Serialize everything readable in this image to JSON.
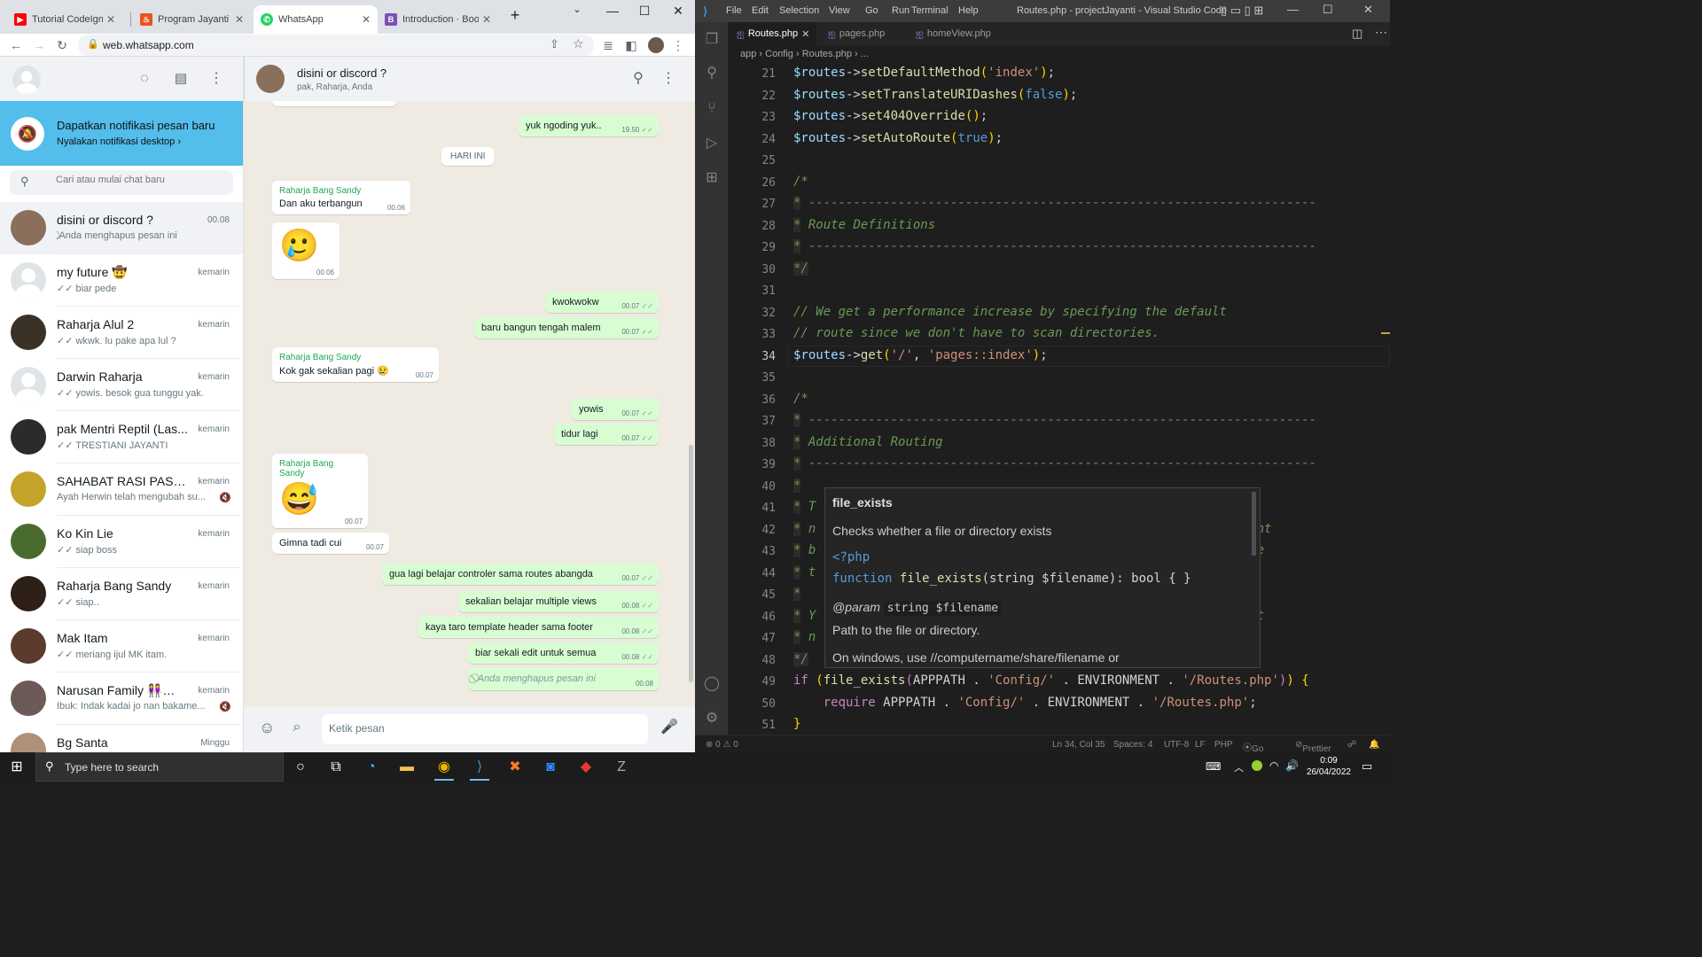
{
  "chrome": {
    "tabs": [
      {
        "title": "Tutorial CodeIgniter",
        "favicon_color": "#ff0000",
        "favicon_glyph": "▶"
      },
      {
        "title": "Program Jayanti",
        "favicon_color": "#e8541c",
        "favicon_glyph": "🔥"
      },
      {
        "title": "WhatsApp",
        "favicon_color": "#25d366",
        "favicon_glyph": "✆"
      },
      {
        "title": "Introduction · Boots",
        "favicon_color": "#7952b3",
        "favicon_glyph": "B"
      }
    ],
    "new_tab_glyph": "+",
    "url": "web.whatsapp.com",
    "window_controls": {
      "minimize": "—",
      "maximize": "☐",
      "close": "✕"
    }
  },
  "whatsapp": {
    "notification": {
      "title": "Dapatkan notifikasi pesan baru",
      "subtitle": "Nyalakan notifikasi desktop ›"
    },
    "search_placeholder": "Cari atau mulai chat baru",
    "chats": [
      {
        "name": "disini or discord ?",
        "time": "00.08",
        "last": "⃠ Anda menghapus pesan ini",
        "avatar_color": "#8a6f5b",
        "selected": true
      },
      {
        "name": "my future 🤠",
        "time": "kemarin",
        "last": "✓✓ biar pede",
        "avatar_color": "generic"
      },
      {
        "name": "Raharja Alul 2",
        "time": "kemarin",
        "last": "✓✓ wkwk. lu pake apa lul ?",
        "avatar_color": "#3a3226"
      },
      {
        "name": "Darwin Raharja",
        "time": "kemarin",
        "last": "✓✓ yowis. besok gua tunggu yak.",
        "avatar_color": "generic"
      },
      {
        "name": "pak Mentri Reptil (Las...",
        "time": "kemarin",
        "last": "✓✓ TRESTIANI JAYANTI",
        "avatar_color": "#2b2b2b"
      },
      {
        "name": "SAHABAT RASI PASAR ...",
        "time": "kemarin",
        "last": "Ayah Herwin telah mengubah su...",
        "avatar_color": "#c4a32a",
        "muted": true
      },
      {
        "name": "Ko Kin Lie",
        "time": "kemarin",
        "last": "✓✓ siap boss",
        "avatar_color": "#4a6b2e"
      },
      {
        "name": "Raharja Bang Sandy",
        "time": "kemarin",
        "last": "✓✓ siap..",
        "avatar_color": "#2e2018"
      },
      {
        "name": "Mak Itam",
        "time": "kemarin",
        "last": "✓✓ meriang ijul MK itam.",
        "avatar_color": "#5a3b2c"
      },
      {
        "name": "Narusan Family 👭👫👭",
        "time": "kemarin",
        "last": "Ibuk: Indak kadai jo nan bakame...",
        "avatar_color": "#6c5a58",
        "muted": true
      },
      {
        "name": "Bg Santa",
        "time": "Minggu",
        "last": "",
        "avatar_color": "#b09078"
      }
    ],
    "conversation": {
      "title": "disini or discord ?",
      "members": "pak, Raharja, Anda",
      "date_separator": "HARI INI",
      "composer_placeholder": "Ketik pesan",
      "messages": [
        {
          "dir": "out",
          "text": "yuk ngoding yuk..",
          "time": "19.50"
        },
        {
          "dir": "in",
          "sender": "Raharja Bang Sandy",
          "text": "Dan aku terbangun",
          "time": "00.06"
        },
        {
          "dir": "in",
          "emoji": "🥲",
          "time": "00.06"
        },
        {
          "dir": "out",
          "text": "kwokwokw",
          "time": "00.07"
        },
        {
          "dir": "out",
          "text": "baru bangun tengah malem",
          "time": "00.07"
        },
        {
          "dir": "in",
          "sender": "Raharja Bang Sandy",
          "text": "Kok gak sekalian pagi 😢",
          "time": "00.07"
        },
        {
          "dir": "out",
          "text": "yowis",
          "time": "00.07"
        },
        {
          "dir": "out",
          "text": "tidur lagi",
          "time": "00.07"
        },
        {
          "dir": "in",
          "sender": "Raharja Bang Sandy",
          "emoji": "😅",
          "time": "00.07"
        },
        {
          "dir": "in",
          "text": "Gimna tadi cui",
          "time": "00.07"
        },
        {
          "dir": "out",
          "text": "gua lagi belajar controler sama routes abangda",
          "time": "00.07"
        },
        {
          "dir": "out",
          "text": "sekalian belajar multiple views",
          "time": "00.08"
        },
        {
          "dir": "out",
          "text": "kaya taro template header sama footer",
          "time": "00.08"
        },
        {
          "dir": "out",
          "text": "biar sekali edit untuk semua",
          "time": "00.08"
        },
        {
          "dir": "out",
          "text": "⃠  Anda menghapus pesan ini",
          "time": "00.08",
          "deleted": true
        }
      ]
    }
  },
  "vscode": {
    "window_title": "Routes.php - projectJayanti - Visual Studio Code",
    "menu": [
      "File",
      "Edit",
      "Selection",
      "View",
      "Go",
      "Run",
      "Terminal",
      "Help"
    ],
    "tabs": [
      "Routes.php",
      "pages.php",
      "homeView.php"
    ],
    "breadcrumb": "app › Config › Routes.php › ...",
    "current_line": 34,
    "hover": {
      "function": "file_exists",
      "description": "Checks whether a file or directory exists",
      "php_open": "<?php",
      "signature_kw": "function",
      "signature_name": "file_exists",
      "signature_args": "(string $filename): bool { }",
      "param_tag": "@param",
      "param_chip": "string $filename",
      "param_desc": "Path to the file or directory.",
      "note": "On windows, use //computername/share/filename or"
    },
    "statusbar": {
      "problems": "⊗ 0 ⚠ 0",
      "position": "Ln 34, Col 35",
      "spaces": "Spaces: 4",
      "encoding": "UTF-8",
      "eol": "LF",
      "language": "PHP",
      "golive": "Go Live",
      "prettier": "Prettier"
    }
  },
  "taskbar": {
    "search_placeholder": "Type here to search",
    "time": "0:09",
    "date": "26/04/2022"
  }
}
